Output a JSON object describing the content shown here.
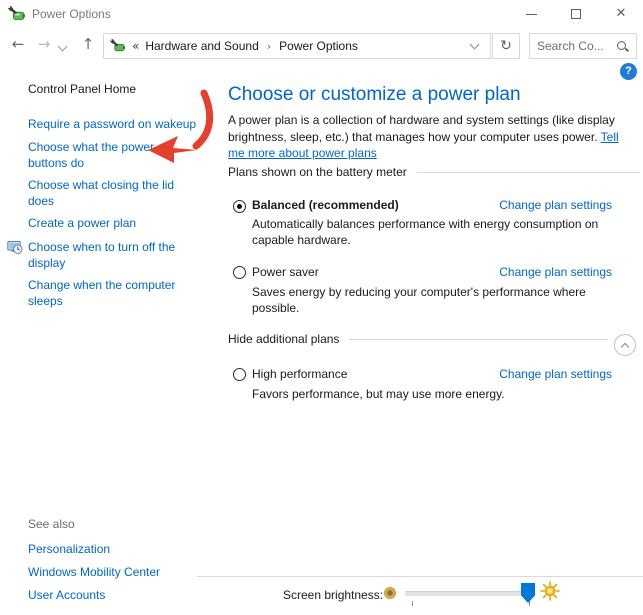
{
  "window": {
    "title": "Power Options",
    "close_glyph": "✕"
  },
  "navbar": {
    "back_glyph": "←",
    "forward_glyph": "→",
    "up_glyph": "↑",
    "refresh_glyph": "↻",
    "breadcrumb": {
      "leading_chevrons": "«",
      "separator": "›",
      "items": [
        "Hardware and Sound",
        "Power Options"
      ]
    },
    "search_placeholder": "Search Co..."
  },
  "sidebar": {
    "home_label": "Control Panel Home",
    "tasks": [
      {
        "label": "Require a password on wakeup"
      },
      {
        "label": "Choose what the power buttons do"
      },
      {
        "label": "Choose what closing the lid does"
      },
      {
        "label": "Create a power plan"
      },
      {
        "label": "Choose when to turn off the display",
        "icon": "display-clock-icon"
      },
      {
        "label": "Change when the computer sleeps",
        "icon": "moon-icon"
      }
    ],
    "see_also": {
      "header": "See also",
      "links": [
        "Personalization",
        "Windows Mobility Center",
        "User Accounts"
      ]
    }
  },
  "main": {
    "heading": "Choose or customize a power plan",
    "intro_text": "A power plan is a collection of hardware and system settings (like display brightness, sleep, etc.) that manages how your computer uses power.",
    "intro_link": "Tell me more about power plans",
    "sections": [
      {
        "header": "Plans shown on the battery meter",
        "plans": [
          {
            "name": "Balanced (recommended)",
            "selected": true,
            "description": "Automatically balances performance with energy consumption on capable hardware.",
            "link": "Change plan settings"
          },
          {
            "name": "Power saver",
            "selected": false,
            "description": "Saves energy by reducing your computer's performance where possible.",
            "link": "Change plan settings"
          }
        ]
      },
      {
        "header": "Hide additional plans",
        "collapsible": true,
        "plans": [
          {
            "name": "High performance",
            "selected": false,
            "description": "Favors performance, but may use more energy.",
            "link": "Change plan settings"
          }
        ]
      }
    ]
  },
  "footer": {
    "brightness_label": "Screen brightness:",
    "brightness_level_percent": 90
  },
  "colors": {
    "link_blue": "#0066cc",
    "heading_blue": "#0066cc",
    "slider_blue": "#0078d7",
    "annotation_red": "#e5402d",
    "sun_gold": "#f2b200",
    "help_blue": "#1e7cd7"
  }
}
